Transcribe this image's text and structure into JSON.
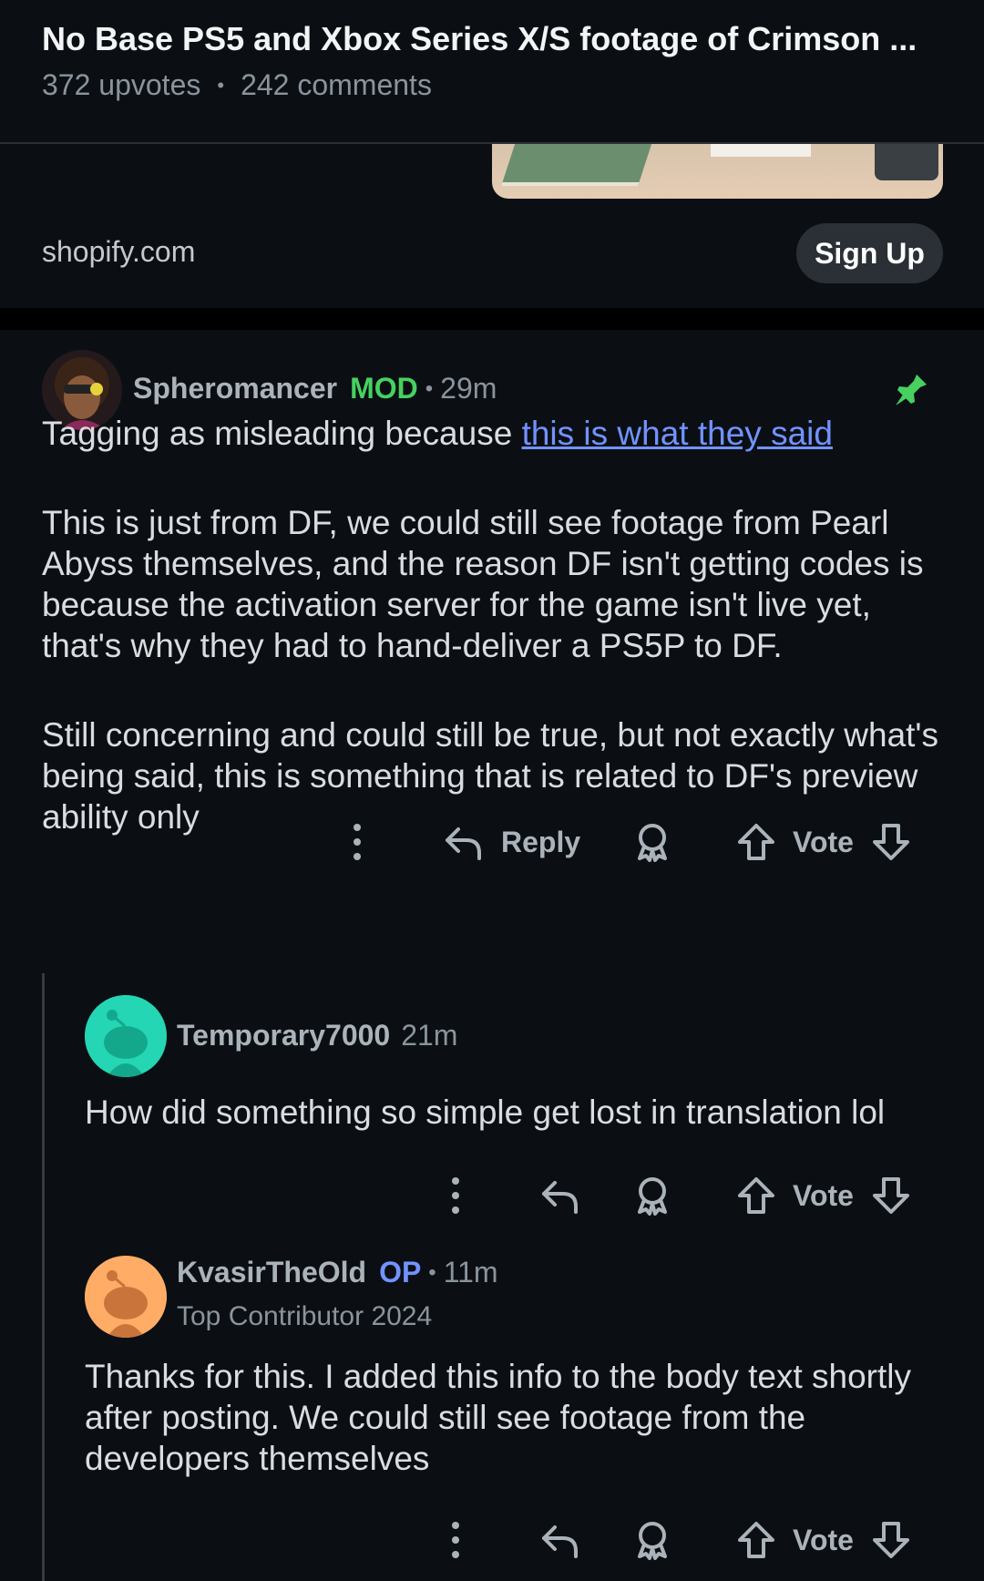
{
  "header": {
    "title": "No Base PS5 and Xbox Series X/S footage of Crimson ...",
    "upvotes": "372 upvotes",
    "dot": "•",
    "comments": "242 comments"
  },
  "ad": {
    "domain": "shopify.com",
    "cta": "Sign Up"
  },
  "comments": [
    {
      "username": "Spheromancer",
      "badge": "MOD",
      "separator": "•",
      "time": "29m",
      "pinned_icon": "pin-icon",
      "body": {
        "line1_prefix": "Tagging as misleading because ",
        "line1_link": "this is what they said",
        "para2": "This is just from DF, we could still see footage from Pearl Abyss themselves, and the reason DF isn't getting codes is because the activation server for the game isn't live yet, that's why they had to hand-deliver a PS5P to DF.",
        "para3": "Still concerning and could still be true, but not exactly what's being said, this is something that is related to DF's preview ability only"
      },
      "actions": {
        "reply": "Reply",
        "vote": "Vote"
      }
    },
    {
      "username": "Temporary7000",
      "time": "21m",
      "body": "How did something so simple get lost in translation lol",
      "actions": {
        "vote": "Vote"
      }
    },
    {
      "username": "KvasirTheOld",
      "badge": "OP",
      "separator": "•",
      "time": "11m",
      "flair": "Top Contributor 2024",
      "body": "Thanks for this. I added this info to the body text shortly after posting. We could still see footage from the developers themselves",
      "actions": {
        "vote": "Vote"
      }
    }
  ],
  "colors": {
    "background": "#0b0f14",
    "mod_green": "#46d160",
    "op_blue": "#7193ff",
    "link_blue": "#7193ff",
    "pin_green": "#46d160"
  }
}
